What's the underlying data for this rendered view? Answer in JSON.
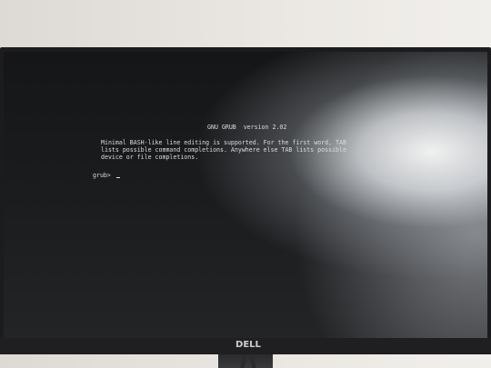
{
  "screen": {
    "title": "GNU GRUB  version 2.02",
    "help_lines": [
      "Minimal BASH-like line editing is supported. For the first word, TAB",
      "lists possible command completions. Anywhere else TAB lists possible",
      "device or file completions."
    ],
    "prompt": "grub> "
  },
  "monitor": {
    "brand_logo": "DELL"
  },
  "colors": {
    "screen_text": "#d9dcdf",
    "bezel": "#1c1c1e",
    "wall": "#e6e3de"
  }
}
